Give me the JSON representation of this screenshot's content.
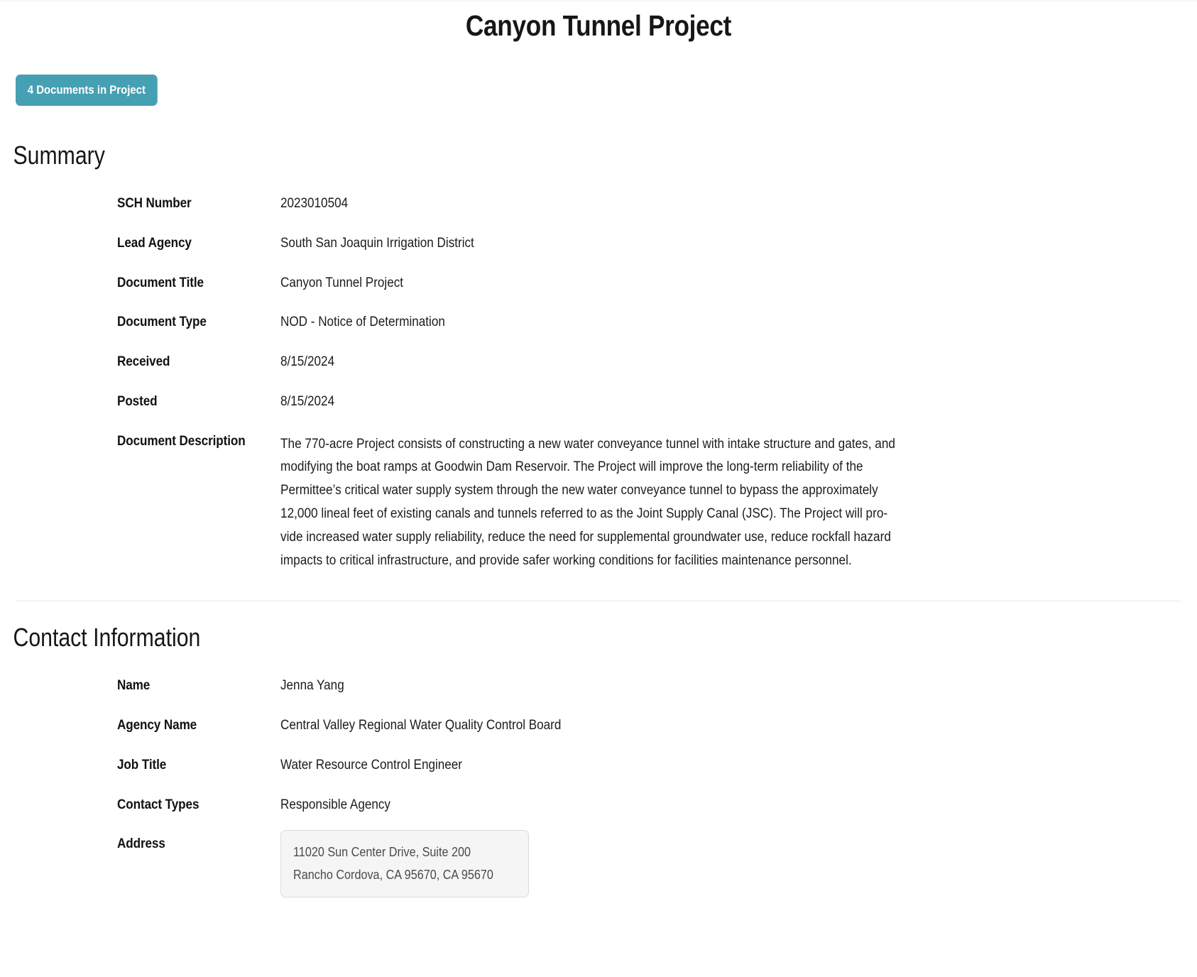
{
  "page": {
    "title": "Canyon Tunnel Project"
  },
  "badge": {
    "label": "4 Documents in Project",
    "color": "#45a0b3",
    "text_color": "#ffffff"
  },
  "summary": {
    "heading": "Summary",
    "rows": [
      {
        "label": "SCH Number",
        "value": "2023010504"
      },
      {
        "label": "Lead Agency",
        "value": "South San Joaquin Irrigation District"
      },
      {
        "label": "Document Title",
        "value": "Canyon Tunnel Project"
      },
      {
        "label": "Document Type",
        "value": "NOD - Notice of Determination"
      },
      {
        "label": "Received",
        "value": "8/15/2024"
      },
      {
        "label": "Posted",
        "value": "8/15/2024"
      }
    ],
    "description_label": "Document Description",
    "description": "The 770-acre Project consists of constructing a new water conveyance tunnel with intake structure and gates, and modifying the boat ramps at Goodwin Dam Reservoir. The Project will improve the long-term reliability of the Permittee’s critical water supply system through the new water conveyance tunnel to bypass the approximately 12,000 lineal feet of existing canals and tunnels referred to as the Joint Supply Canal (JSC). The Project will provide increased water supply reliability, reduce the need for supplemental groundwater use, reduce rockfall hazard impacts to critical infrastructure, and provide safer working conditions for facilities maintenance personnel.",
    "description_lines": [
      "The 770-acre Project consists of constructing a new water conveyance tunnel with intake structure and gates, and",
      "modifying the boat ramps at Goodwin Dam Reservoir. The Project will improve the long-term reliability of the",
      "Permittee’s critical water supply system through the new water conveyance tunnel to bypass the approximately",
      "12,000 lineal feet of existing canals and tunnels referred to as the Joint Supply Canal (JSC). The Project will pro-",
      "vide increased water supply reliability, reduce the need for supplemental groundwater use, reduce rockfall hazard",
      "impacts to critical infrastructure, and provide safer working conditions for facilities maintenance personnel."
    ]
  },
  "contact": {
    "heading": "Contact Information",
    "rows": [
      {
        "label": "Name",
        "value": "Jenna Yang"
      },
      {
        "label": "Agency Name",
        "value": "Central Valley Regional Water Quality Control Board"
      },
      {
        "label": "Job Title",
        "value": "Water Resource Control Engineer"
      },
      {
        "label": "Contact Types",
        "value": "Responsible Agency"
      }
    ],
    "address_label": "Address",
    "address_lines": [
      "11020 Sun Center Drive, Suite 200",
      "Rancho Cordova, CA 95670, CA 95670"
    ]
  }
}
